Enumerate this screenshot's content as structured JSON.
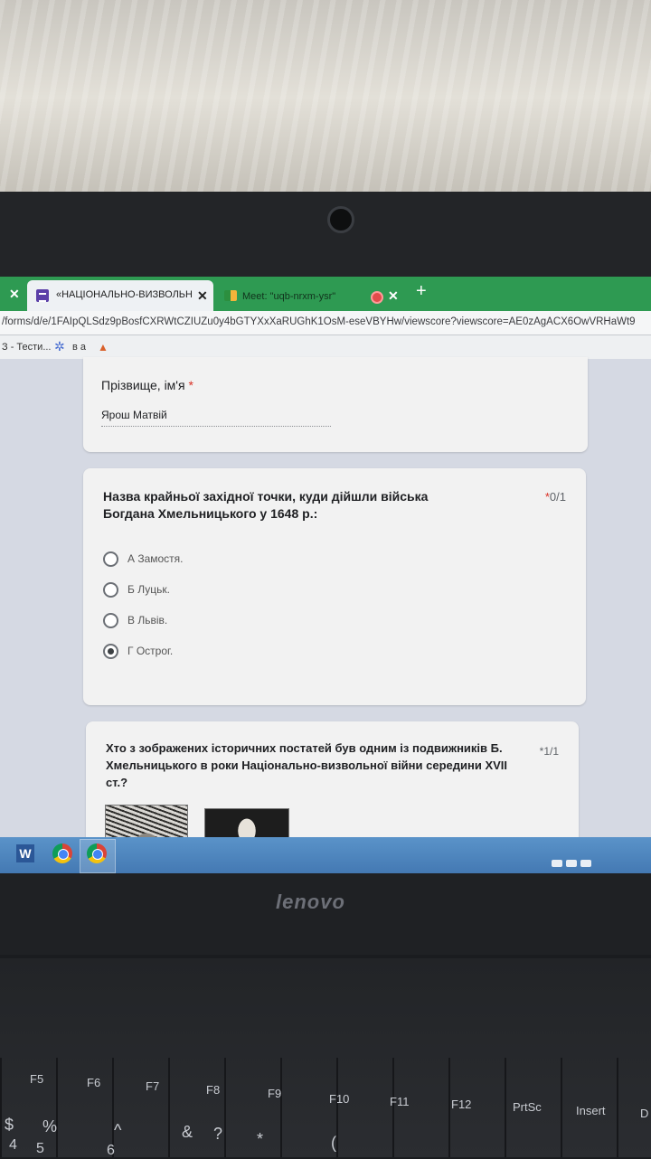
{
  "browser": {
    "tabs": [
      {
        "title": "«НАЦІОНАЛЬНО-ВИЗВОЛЬНА В",
        "close": "✕"
      },
      {
        "title": "Meet: \"uqb-nrxm-ysr\"",
        "close": "✕"
      }
    ],
    "first_close": "✕",
    "new_tab": "+",
    "url": "/forms/d/e/1FAIpQLSdz9pBosfCXRWtCZIUZu0y4bGTYXxXaRUGhK1OsM-eseVBYHw/viewscore?viewscore=AE0zAgACX6OwVRHaWt9",
    "bookmarks": [
      {
        "label": "З - Тести..."
      },
      {
        "label": "в а"
      }
    ]
  },
  "form": {
    "name_field": {
      "label": "Прізвище, ім'я",
      "required_mark": "*",
      "value": "Ярош Матвій"
    },
    "question1": {
      "text": "Назва крайньої західної точки, куди дійшли війська Богдана Хмельницького у 1648 р.:",
      "score_mark": "*",
      "score": "0/1",
      "options": [
        {
          "label": "А Замостя.",
          "selected": false
        },
        {
          "label": "Б Луцьк.",
          "selected": false
        },
        {
          "label": "В Львів.",
          "selected": false
        },
        {
          "label": "Г Острог.",
          "selected": true
        }
      ]
    },
    "question2": {
      "text": "Хто з зображених історичних постатей був одним із подвижників Б. Хмельницького в роки Національно-визвольної війни середини XVII ст.?",
      "score_mark": "*",
      "score": "1/1"
    }
  },
  "taskbar": {
    "word_glyph": "W"
  },
  "laptop": {
    "brand": "lenovo"
  },
  "keyboard": {
    "keys": [
      "F5",
      "F6",
      "F7",
      "F8",
      "F9",
      "F10",
      "F11",
      "F12",
      "PrtSc",
      "Insert",
      "D",
      "$",
      "%",
      "^",
      "&",
      "?",
      "*",
      "(",
      "4",
      "5",
      "6"
    ]
  },
  "colors": {
    "tab_bar": "#2e9a52",
    "required": "#d93025",
    "taskbar": "#4479b3"
  }
}
